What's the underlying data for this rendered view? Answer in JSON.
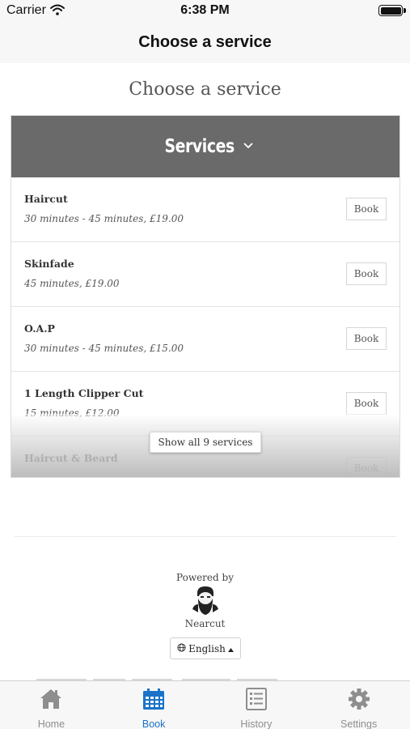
{
  "status_bar": {
    "carrier": "Carrier",
    "time": "6:38 PM"
  },
  "nav": {
    "title": "Choose a service"
  },
  "page": {
    "heading": "Choose a service"
  },
  "services": {
    "header": "Services",
    "items": [
      {
        "name": "Haircut",
        "detail": "30 minutes - 45 minutes, £19.00",
        "book_label": "Book"
      },
      {
        "name": "Skinfade",
        "detail": "45 minutes, £19.00",
        "book_label": "Book"
      },
      {
        "name": "O.A.P",
        "detail": "30 minutes - 45 minutes, £15.00",
        "book_label": "Book"
      },
      {
        "name": "1 Length Clipper Cut",
        "detail": "15 minutes, £12.00",
        "book_label": "Book"
      },
      {
        "name": "Haircut & Beard",
        "detail": "",
        "book_label": "Book"
      }
    ],
    "show_all_label": "Show all 9 services"
  },
  "footer": {
    "powered_by": "Powered by",
    "brand_name": "Nearcut",
    "language": "English"
  },
  "tabs": [
    {
      "label": "Home",
      "icon": "home-icon",
      "active": false
    },
    {
      "label": "Book",
      "icon": "calendar-icon",
      "active": true
    },
    {
      "label": "History",
      "icon": "list-icon",
      "active": false
    },
    {
      "label": "Settings",
      "icon": "gear-icon",
      "active": false
    }
  ],
  "colors": {
    "header_bg": "#6a6a6a",
    "tab_active": "#1a73c9",
    "tab_inactive": "#8e8e8e"
  }
}
